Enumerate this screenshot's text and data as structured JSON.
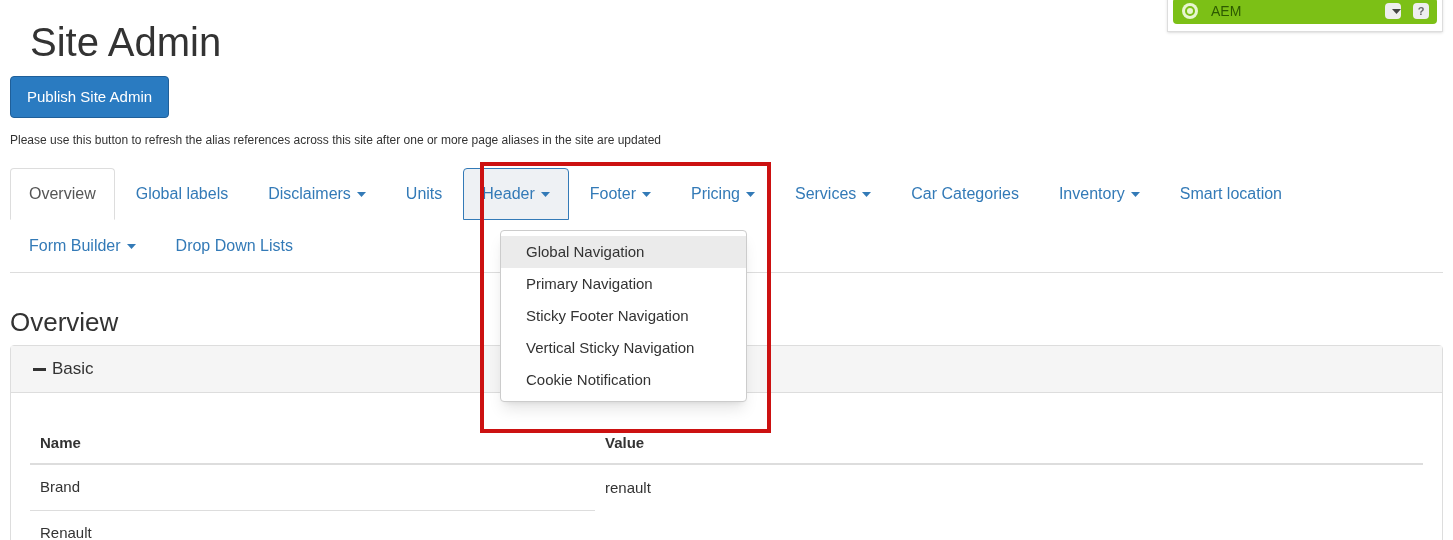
{
  "aem_bar": {
    "label": "AEM",
    "help": "?"
  },
  "title": "Site Admin",
  "publish_button": "Publish Site Admin",
  "help_text": "Please use this button to refresh the alias references across this site after one or more page aliases in the site are updated",
  "tab_rows": [
    [
      {
        "label": "Overview",
        "selected": true,
        "has_menu": false,
        "expanded": false
      },
      {
        "label": "Global labels",
        "selected": false,
        "has_menu": false,
        "expanded": false
      },
      {
        "label": "Disclaimers",
        "selected": false,
        "has_menu": true,
        "expanded": false
      },
      {
        "label": "Units",
        "selected": false,
        "has_menu": false,
        "expanded": false
      },
      {
        "label": "Header",
        "selected": false,
        "has_menu": true,
        "expanded": true
      },
      {
        "label": "Footer",
        "selected": false,
        "has_menu": true,
        "expanded": false
      },
      {
        "label": "Pricing",
        "selected": false,
        "has_menu": true,
        "expanded": false
      },
      {
        "label": "Services",
        "selected": false,
        "has_menu": true,
        "expanded": false
      },
      {
        "label": "Car Categories",
        "selected": false,
        "has_menu": false,
        "expanded": false
      },
      {
        "label": "Inventory",
        "selected": false,
        "has_menu": true,
        "expanded": false
      },
      {
        "label": "Smart location",
        "selected": false,
        "has_menu": false,
        "expanded": false
      }
    ],
    [
      {
        "label": "Form Builder",
        "selected": false,
        "has_menu": true,
        "expanded": false
      },
      {
        "label": "Drop Down Lists",
        "selected": false,
        "has_menu": false,
        "expanded": false
      }
    ]
  ],
  "header_menu": [
    {
      "label": "Global Navigation",
      "selected": true
    },
    {
      "label": "Primary Navigation",
      "selected": false
    },
    {
      "label": "Sticky Footer Navigation",
      "selected": false
    },
    {
      "label": "Vertical Sticky Navigation",
      "selected": false
    },
    {
      "label": "Cookie Notification",
      "selected": false
    }
  ],
  "section_title": "Overview",
  "panel": {
    "title": "Basic",
    "expanded": true,
    "columns": [
      "Name",
      "Value"
    ],
    "rows": [
      {
        "name": "Brand",
        "value": "renault"
      },
      {
        "name": "Renault"
      }
    ]
  }
}
